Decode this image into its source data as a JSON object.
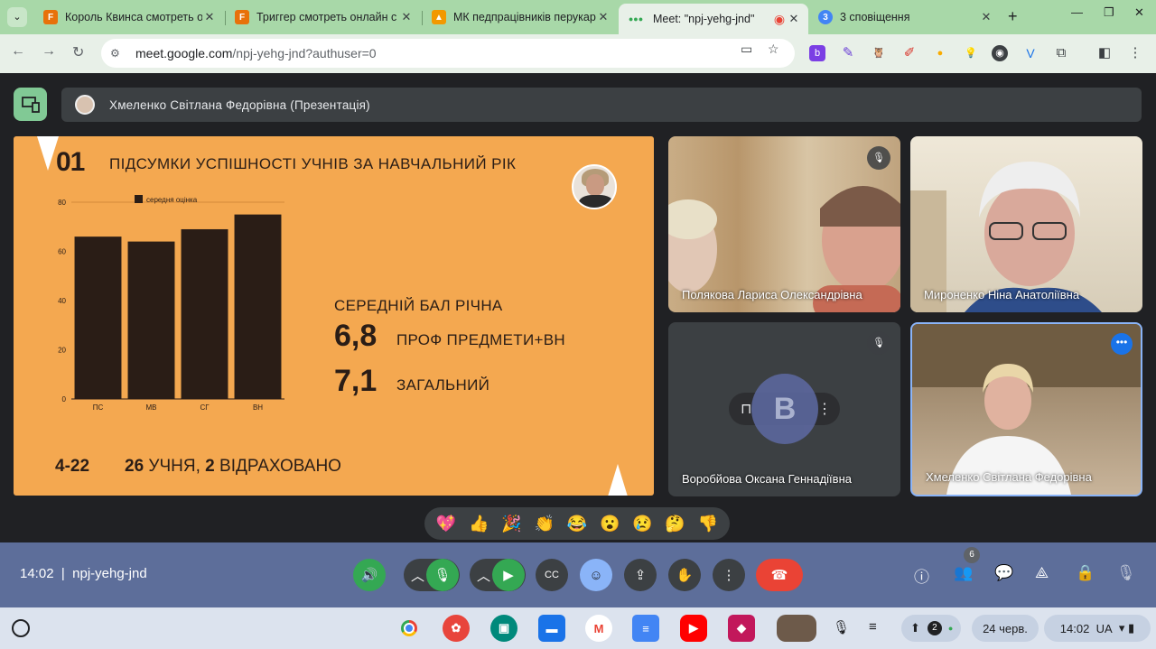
{
  "browser": {
    "tabs": [
      {
        "title": "Король Квинса смотреть о",
        "favicon": "F",
        "color": "#e8710a"
      },
      {
        "title": "Триггер смотреть онлайн с",
        "favicon": "F",
        "color": "#e8710a"
      },
      {
        "title": "МК педпрацівників перукар",
        "favicon": "●",
        "color": "#f29900"
      },
      {
        "title": "Meet: \"npj-yehg-jnd\"",
        "favicon": "●●●",
        "color": "#34a853",
        "active": true
      },
      {
        "title": "3 сповіщення",
        "favicon": "3",
        "color": "#4285f4"
      }
    ],
    "url_host": "meet.google.com",
    "url_path": "/npj-yehg-jnd?authuser=0"
  },
  "meet": {
    "presenter_label": "Хмеленко Світлана Федорівна (Презентація)",
    "time": "14:02",
    "separator": "|",
    "meeting_code": "npj-yehg-jnd",
    "participants_count": "6",
    "reactions": [
      "💖",
      "👍",
      "🎉",
      "👏",
      "😂",
      "😮",
      "😢",
      "🤔",
      "👎"
    ]
  },
  "slide": {
    "number": "01",
    "title": "ПІДСУМКИ УСПІШНОСТІ УЧНІВ ЗА НАВЧАЛЬНИЙ РІК",
    "stats_heading": "СЕРЕДНІЙ БАЛ РІЧНА",
    "stat1_value": "6,8",
    "stat1_label": "ПРОФ ПРЕДМЕТИ+ВН",
    "stat2_value": "7,1",
    "stat2_label": "ЗАГАЛЬНИЙ",
    "footer_group": "4-22",
    "footer_count": "26",
    "footer_text1": "УЧНЯ,",
    "footer_num2": "2",
    "footer_text2": "ВІДРАХОВАНО"
  },
  "chart_data": {
    "type": "bar",
    "categories": [
      "ПС",
      "МВ",
      "СГ",
      "ВН"
    ],
    "series": [
      {
        "name": "середня оцінка",
        "values": [
          66,
          64,
          69,
          75
        ]
      }
    ],
    "ylim": [
      0,
      80
    ],
    "yticks": [
      "0",
      "20",
      "40",
      "60",
      "80"
    ],
    "legend": "top",
    "bar_color": "#2a1d16",
    "grid": false
  },
  "tiles": [
    {
      "name": "Полякова Лариса Олександрівна",
      "muted": true
    },
    {
      "name": "Мироненко Ніна Анатоліївна",
      "muted": false
    },
    {
      "name": "Воробйова Оксана Геннадіївна",
      "muted": true,
      "avatar_letter": "В"
    },
    {
      "name": "Хмеленко Світлана Федорівна",
      "muted": false
    }
  ],
  "shelf": {
    "date": "24 черв.",
    "time": "14:02",
    "lang": "UA",
    "notif": "2"
  },
  "colors": {
    "slide_bg": "#f4a850",
    "end_call": "#ea4335",
    "active_ctl": "#34a853",
    "chrome_theme": "#a8d8a8"
  }
}
